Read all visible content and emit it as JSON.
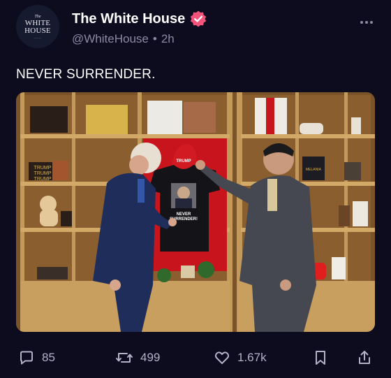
{
  "author": {
    "display_name": "The White House",
    "handle": "@WhiteHouse",
    "separator": "•",
    "time": "2h",
    "avatar_text": {
      "top": "The",
      "main_line1": "WHITE",
      "main_line2": "HOUSE"
    },
    "verified_color": "#f4547b"
  },
  "post": {
    "text": "NEVER SURRENDER."
  },
  "media": {
    "shirt_text_line1": "NEVER",
    "shirt_text_line2": "SURRENDER!",
    "cap_text": "TRUMP",
    "book_text": "MELANIA",
    "sign_line1": "TRUMP",
    "sign_line2": "TRUMP",
    "sign_line3": "TRUMP"
  },
  "actions": {
    "replies": "85",
    "reposts": "499",
    "likes": "1.67k"
  },
  "colors": {
    "background": "#0d0b1e",
    "muted_text": "#8b8aa3",
    "action_text": "#b3b2c6"
  }
}
